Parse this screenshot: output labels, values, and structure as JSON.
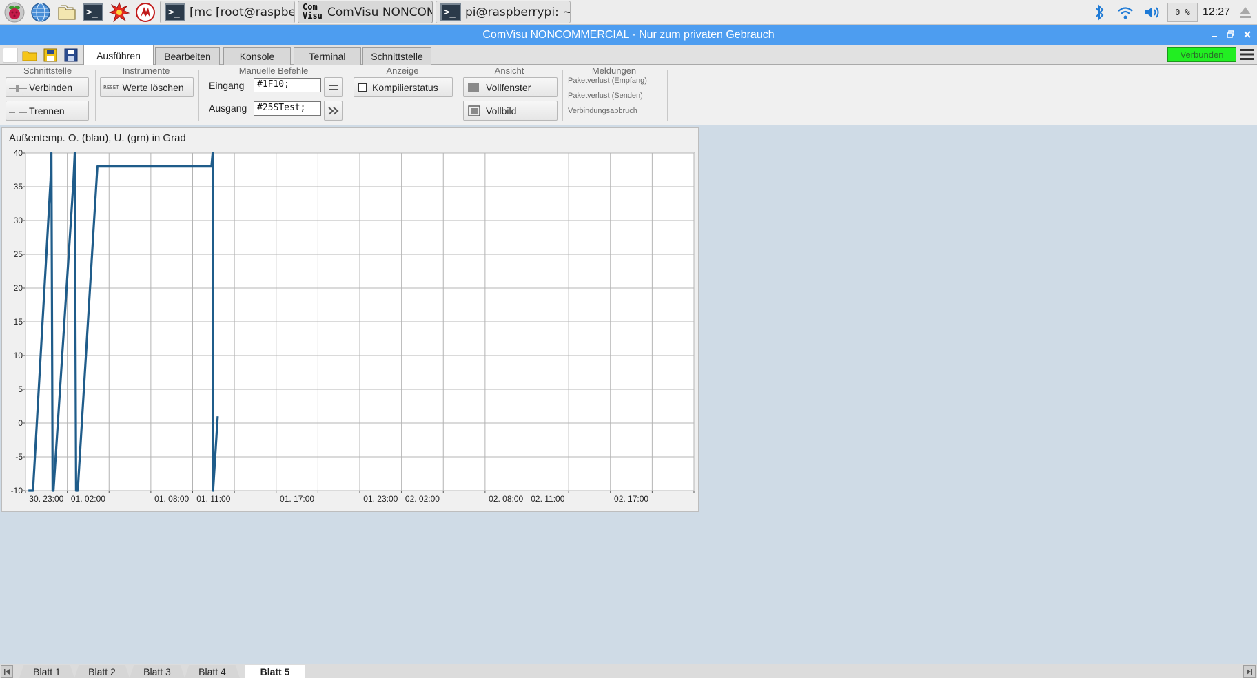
{
  "os_panel": {
    "launchers": [
      {
        "icon": "raspberry-icon"
      },
      {
        "icon": "web-browser-icon"
      },
      {
        "icon": "file-manager-icon"
      },
      {
        "icon": "terminal-icon"
      },
      {
        "icon": "burst-icon"
      },
      {
        "icon": "mathematica-icon"
      }
    ],
    "tasks": [
      {
        "label": "[mc [root@raspberry...",
        "icon": "terminal-icon"
      },
      {
        "label": "ComVisu NONCOM...",
        "icon": "comvisu-icon",
        "icon_text": [
          "Com",
          "Visu"
        ],
        "active": true
      },
      {
        "label": "pi@raspberrypi: ~",
        "icon": "terminal-icon"
      }
    ],
    "terminal_glyph": ">_",
    "cpu": "0 %",
    "clock": "12:27"
  },
  "window": {
    "title": "ComVisu NONCOMMERCIAL - Nur zum privaten Gebrauch"
  },
  "tabs": [
    "Ausführen",
    "Bearbeiten",
    "Konsole",
    "Terminal",
    "Schnittstelle"
  ],
  "active_tab": 0,
  "status_badge": "Verbunden",
  "ribbon": {
    "schnittstelle": {
      "title": "Schnittstelle",
      "connect": "Verbinden",
      "disconnect": "Trennen"
    },
    "instrumente": {
      "title": "Instrumente",
      "reset_icon_text": "RESET",
      "clear": "Werte löschen"
    },
    "manuelle": {
      "title": "Manuelle Befehle",
      "input_label": "Eingang",
      "input_value": "#1F10;",
      "output_label": "Ausgang",
      "output_value": "#25STest;"
    },
    "anzeige": {
      "title": "Anzeige",
      "compile_status": "Kompilierstatus"
    },
    "ansicht": {
      "title": "Ansicht",
      "full_window": "Vollfenster",
      "full_screen": "Vollbild"
    },
    "meldungen": {
      "title": "Meldungen",
      "items": [
        "Paketverlust (Empfang)",
        "Paketverlust (Senden)",
        "Verbindungsabbruch"
      ]
    }
  },
  "chart_data": {
    "type": "line",
    "title": "Außentemp. O. (blau), U. (grn) in Grad",
    "ylim": [
      -10,
      40
    ],
    "yticks": [
      40,
      35,
      30,
      25,
      20,
      15,
      10,
      5,
      0,
      -5,
      -10
    ],
    "xlim": [
      0,
      16
    ],
    "xtick_positions": [
      0,
      1,
      2,
      3,
      4,
      5,
      6,
      7,
      8,
      9,
      10,
      11,
      12,
      13,
      14,
      15,
      16
    ],
    "xtick_labels": [
      {
        "x": 0.5,
        "text": "30. 23:00"
      },
      {
        "x": 1.5,
        "text": "01. 02:00"
      },
      {
        "x": 3.5,
        "text": "01. 08:00"
      },
      {
        "x": 4.5,
        "text": "01. 11:00"
      },
      {
        "x": 6.5,
        "text": "01. 17:00"
      },
      {
        "x": 8.5,
        "text": "01. 23:00"
      },
      {
        "x": 9.5,
        "text": "02. 02:00"
      },
      {
        "x": 11.5,
        "text": "02. 08:00"
      },
      {
        "x": 12.5,
        "text": "02. 11:00"
      },
      {
        "x": 14.5,
        "text": "02. 17:00"
      }
    ],
    "grid": true,
    "series": [
      {
        "color": "#1f5c8a",
        "points": [
          [
            0.07,
            -10
          ],
          [
            0.18,
            -10
          ],
          [
            0.6,
            36
          ],
          [
            0.62,
            40
          ],
          [
            0.65,
            -10
          ],
          [
            0.67,
            -10
          ],
          [
            1.15,
            36
          ],
          [
            1.18,
            40
          ],
          [
            1.21,
            -10
          ],
          [
            1.25,
            -10
          ],
          [
            1.72,
            38
          ],
          [
            4.45,
            38
          ],
          [
            4.48,
            40
          ],
          [
            4.49,
            -10
          ],
          [
            4.6,
            1
          ]
        ]
      }
    ]
  },
  "sheets": [
    "Blatt 1",
    "Blatt 2",
    "Blatt 3",
    "Blatt 4",
    "Blatt 5"
  ],
  "active_sheet": 4,
  "colors": {
    "titlebar": "#4d9df0",
    "status_green": "#22ee22",
    "workspace": "#cfdbe6",
    "series_blue": "#1f5c8a"
  }
}
